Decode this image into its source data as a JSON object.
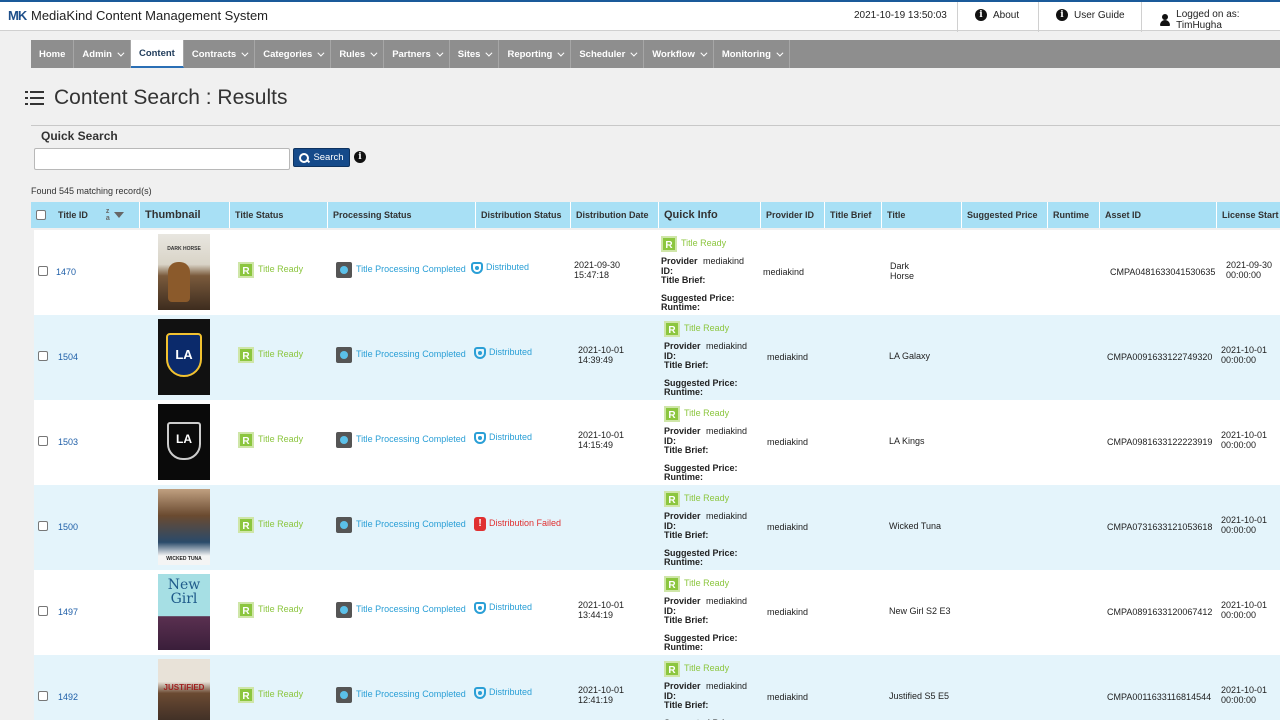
{
  "header": {
    "logo": "MK",
    "app_title": "MediaKind Content Management System",
    "datetime": "2021-10-19 13:50:03",
    "about": "About",
    "user_guide": "User Guide",
    "logged_on": "Logged on as: TimHugha"
  },
  "nav": [
    {
      "label": "Home",
      "caret": false,
      "active": false
    },
    {
      "label": "Admin",
      "caret": true,
      "active": false
    },
    {
      "label": "Content",
      "caret": false,
      "active": true
    },
    {
      "label": "Contracts",
      "caret": true,
      "active": false
    },
    {
      "label": "Categories",
      "caret": true,
      "active": false
    },
    {
      "label": "Rules",
      "caret": true,
      "active": false
    },
    {
      "label": "Partners",
      "caret": true,
      "active": false
    },
    {
      "label": "Sites",
      "caret": true,
      "active": false
    },
    {
      "label": "Reporting",
      "caret": true,
      "active": false
    },
    {
      "label": "Scheduler",
      "caret": true,
      "active": false
    },
    {
      "label": "Workflow",
      "caret": true,
      "active": false
    },
    {
      "label": "Monitoring",
      "caret": true,
      "active": false
    }
  ],
  "page_title": "Content Search : Results",
  "quick_search": {
    "label": "Quick Search",
    "value": "",
    "button": "Search"
  },
  "found_text": "Found 545 matching record(s)",
  "sort_glyph": "z\na",
  "columns": [
    "Title ID",
    "Thumbnail",
    "Title Status",
    "Processing Status",
    "Distribution Status",
    "Distribution Date",
    "Quick Info",
    "Provider ID",
    "Title Brief",
    "Title",
    "Suggested Price",
    "Runtime",
    "Asset ID",
    "License Start"
  ],
  "quick_info_labels": {
    "status": "Title Ready",
    "provider_id": "Provider ID:",
    "title_brief": "Title Brief:",
    "suggested_price": "Suggested Price:",
    "runtime": "Runtime:"
  },
  "rows": [
    {
      "id": "1470",
      "thumb": "dark-horse",
      "thumb_text": "DARK HORSE",
      "title_status": "Title Ready",
      "processing": "Title Processing Completed",
      "distribution": "Distributed",
      "dist_ok": true,
      "dist_date": "2021-09-30\n15:47:18",
      "provider": "mediakind",
      "title": "Dark\nHorse",
      "asset_id": "CMPA0481633041530635",
      "license_start": "2021-09-30\n00:00:00"
    },
    {
      "id": "1504",
      "thumb": "la-galaxy",
      "thumb_text": "LA",
      "title_status": "Title Ready",
      "processing": "Title Processing Completed",
      "distribution": "Distributed",
      "dist_ok": true,
      "dist_date": "2021-10-01\n14:39:49",
      "provider": "mediakind",
      "title": "LA Galaxy",
      "asset_id": "CMPA0091633122749320",
      "license_start": "2021-10-01\n00:00:00"
    },
    {
      "id": "1503",
      "thumb": "la-kings",
      "thumb_text": "LA",
      "title_status": "Title Ready",
      "processing": "Title Processing Completed",
      "distribution": "Distributed",
      "dist_ok": true,
      "dist_date": "2021-10-01\n14:15:49",
      "provider": "mediakind",
      "title": "LA Kings",
      "asset_id": "CMPA0981633122223919",
      "license_start": "2021-10-01\n00:00:00"
    },
    {
      "id": "1500",
      "thumb": "wicked-tuna",
      "thumb_text": "WICKED TUNA",
      "title_status": "Title Ready",
      "processing": "Title Processing Completed",
      "distribution": "Distribution Failed",
      "dist_ok": false,
      "dist_date": "",
      "provider": "mediakind",
      "title": "Wicked Tuna",
      "asset_id": "CMPA0731633121053618",
      "license_start": "2021-10-01\n00:00:00"
    },
    {
      "id": "1497",
      "thumb": "new-girl",
      "thumb_text": "New\nGirl",
      "title_status": "Title Ready",
      "processing": "Title Processing Completed",
      "distribution": "Distributed",
      "dist_ok": true,
      "dist_date": "2021-10-01\n13:44:19",
      "provider": "mediakind",
      "title": "New Girl S2 E3",
      "asset_id": "CMPA0891633120067412",
      "license_start": "2021-10-01\n00:00:00"
    },
    {
      "id": "1492",
      "thumb": "justified",
      "thumb_text": "JUSTIFIED",
      "title_status": "Title Ready",
      "processing": "Title Processing Completed",
      "distribution": "Distributed",
      "dist_ok": true,
      "dist_date": "2021-10-01\n12:41:19",
      "provider": "mediakind",
      "title": "Justified S5 E5",
      "asset_id": "CMPA0011633116814544",
      "license_start": "2021-10-01\n00:00:00"
    }
  ],
  "colors": {
    "accent": "#1a5a9a",
    "header_row": "#a8e0f5",
    "alt_row": "#e4f4fb",
    "ready_green": "#8cc63f",
    "dist_blue": "#2a9fd6",
    "fail_red": "#e03030"
  }
}
